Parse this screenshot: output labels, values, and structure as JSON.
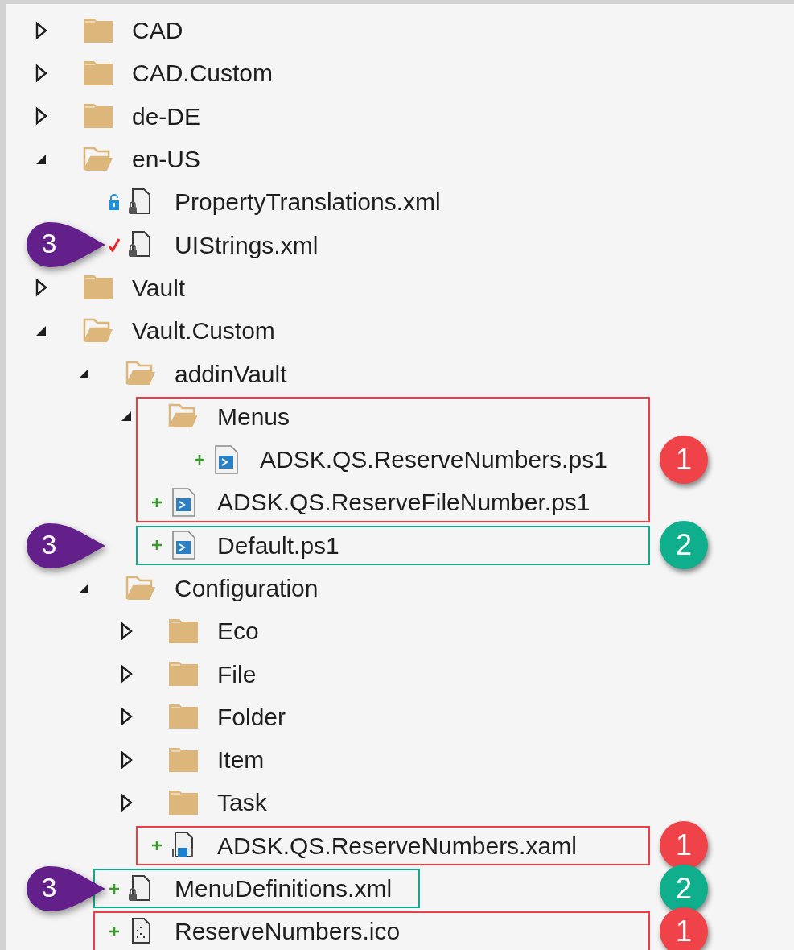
{
  "tree": [
    {
      "kind": "folder",
      "name": "CAD",
      "expanded": false
    },
    {
      "kind": "folder",
      "name": "CAD.Custom",
      "expanded": false
    },
    {
      "kind": "folder",
      "name": "de-DE",
      "expanded": false
    },
    {
      "kind": "folder",
      "name": "en-US",
      "expanded": true,
      "children": [
        {
          "kind": "xml_file",
          "name": "PropertyTranslations.xml",
          "status": {
            "kind": "locked"
          }
        },
        {
          "kind": "xml_file",
          "name": "UIStrings.xml",
          "status": {
            "kind": "checked_out"
          },
          "callout": "3"
        }
      ]
    },
    {
      "kind": "folder",
      "name": "Vault",
      "expanded": false
    },
    {
      "kind": "folder",
      "name": "Vault.Custom",
      "expanded": true,
      "children": [
        {
          "kind": "folder",
          "name": "addinVault",
          "expanded": true,
          "children": [
            {
              "kind": "folder",
              "name": "Menus",
              "expanded": true,
              "box": {
                "color": "#ee3e44",
                "fit": false
              },
              "children": [
                {
                  "kind": "script_file",
                  "name": "ADSK.QS.ReserveNumbers.ps1",
                  "status": {
                    "kind": "added"
                  },
                  "box": {
                    "color": "#ee3e44",
                    "fit": false
                  },
                  "badge": {
                    "label": "1",
                    "color": "#f04349"
                  }
                }
              ]
            },
            {
              "kind": "script_file",
              "name": "ADSK.QS.ReserveFileNumber.ps1",
              "status": {
                "kind": "added"
              },
              "box": {
                "color": "#ee3e44",
                "fit": false
              }
            },
            {
              "kind": "script_file",
              "name": "Default.ps1",
              "status": {
                "kind": "added"
              },
              "callout": "3",
              "box": {
                "color": "#13a88a",
                "fit": false
              },
              "badge": {
                "label": "2",
                "color": "#0fae8c"
              }
            }
          ]
        },
        {
          "kind": "folder",
          "name": "Configuration",
          "expanded": true,
          "children": [
            {
              "kind": "folder",
              "name": "Eco",
              "expanded": false
            },
            {
              "kind": "folder",
              "name": "File",
              "expanded": false
            },
            {
              "kind": "folder",
              "name": "Folder",
              "expanded": false
            },
            {
              "kind": "folder",
              "name": "Item",
              "expanded": false
            },
            {
              "kind": "folder",
              "name": "Task",
              "expanded": false
            },
            {
              "kind": "xaml_file",
              "name": "ADSK.QS.ReserveNumbers.xaml",
              "status": {
                "kind": "added"
              },
              "box": {
                "color": "#ee3e44",
                "fit": false
              },
              "badge": {
                "label": "1",
                "color": "#f04349"
              }
            }
          ]
        },
        {
          "kind": "xml_file",
          "name": "MenuDefinitions.xml",
          "status": {
            "kind": "added"
          },
          "callout": "3",
          "box": {
            "color": "#13a88a",
            "fit": true
          },
          "badge": {
            "label": "2",
            "color": "#0fae8c"
          }
        },
        {
          "kind": "icon_file",
          "name": "ReserveNumbers.ico",
          "status": {
            "kind": "added"
          },
          "box": {
            "color": "#ee3e44",
            "fit": false
          },
          "badge": {
            "label": "1",
            "color": "#f04349"
          }
        }
      ]
    }
  ]
}
